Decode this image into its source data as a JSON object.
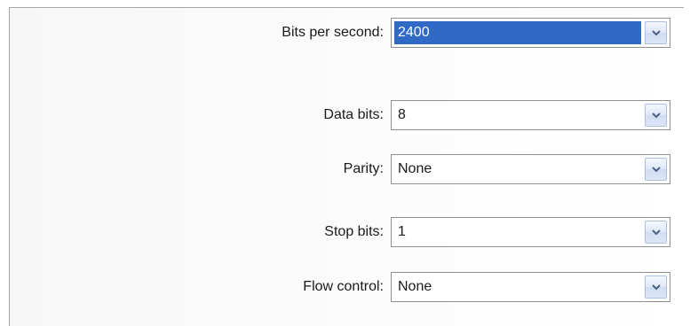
{
  "settings": {
    "rows": [
      {
        "label": "Bits per second:",
        "value": "2400"
      },
      {
        "label": "Data bits:",
        "value": "8"
      },
      {
        "label": "Parity:",
        "value": "None"
      },
      {
        "label": "Stop bits:",
        "value": "1"
      },
      {
        "label": "Flow control:",
        "value": "None"
      }
    ],
    "selected_row": 0
  },
  "colors": {
    "selection": "#3169c6",
    "border": "#8e8f8f",
    "arrow": "#4d6185"
  },
  "icons": {
    "dropdown": "chevron-down-icon"
  }
}
